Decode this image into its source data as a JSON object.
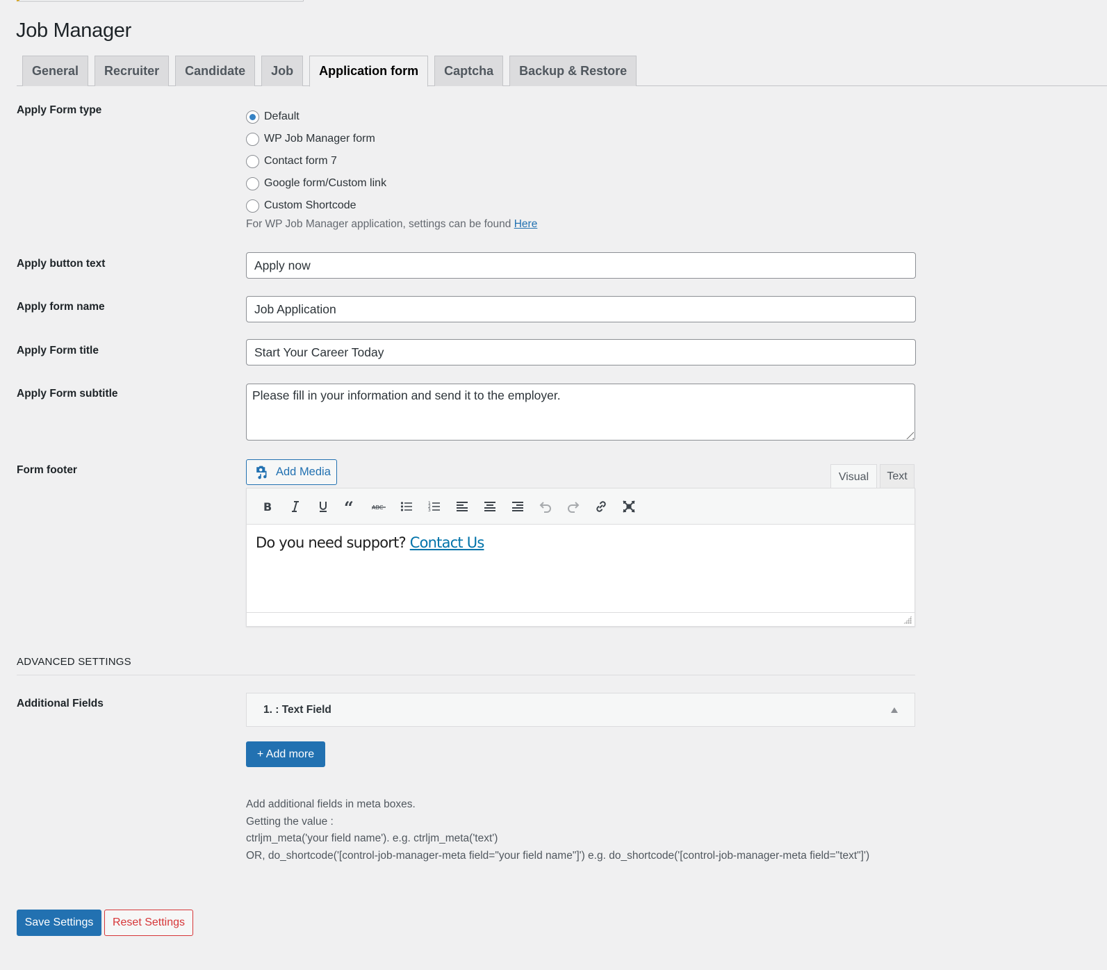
{
  "page": {
    "title": "Job Manager"
  },
  "tabs": [
    {
      "label": "General",
      "active": false
    },
    {
      "label": "Recruiter",
      "active": false
    },
    {
      "label": "Candidate",
      "active": false
    },
    {
      "label": "Job",
      "active": false
    },
    {
      "label": "Application form",
      "active": true
    },
    {
      "label": "Captcha",
      "active": false
    },
    {
      "label": "Backup & Restore",
      "active": false
    }
  ],
  "apply_form_type": {
    "label": "Apply Form type",
    "options": [
      {
        "label": "Default",
        "checked": true
      },
      {
        "label": "WP Job Manager form",
        "checked": false
      },
      {
        "label": "Contact form 7",
        "checked": false
      },
      {
        "label": "Google form/Custom link",
        "checked": false
      },
      {
        "label": "Custom Shortcode",
        "checked": false
      }
    ],
    "note": "For WP Job Manager application, settings can be found ",
    "note_link": "Here"
  },
  "fields": {
    "apply_button_text": {
      "label": "Apply button text",
      "value": "Apply now"
    },
    "apply_form_name": {
      "label": "Apply form name",
      "value": "Job Application"
    },
    "apply_form_title": {
      "label": "Apply Form title",
      "value": "Start Your Career Today"
    },
    "apply_form_subtitle": {
      "label": "Apply Form subtitle",
      "value": "Please fill in your information and send it to the employer."
    }
  },
  "form_footer": {
    "label": "Form footer",
    "add_media_label": "Add Media",
    "visual_tab": "Visual",
    "text_tab": "Text",
    "toolbar": [
      "bold",
      "italic",
      "underline",
      "blockquote",
      "strikethrough",
      "bulleted-list",
      "numbered-list",
      "align-left",
      "align-center",
      "align-right",
      "undo",
      "redo",
      "link",
      "fullscreen"
    ],
    "content_text": "Do you need support? ",
    "content_link": "Contact Us"
  },
  "advanced": {
    "heading": "ADVANCED SETTINGS",
    "additional_fields_label": "Additional Fields",
    "items": [
      {
        "label": "1. : Text Field"
      }
    ],
    "add_more_label": "+ Add more",
    "help_lines": [
      "Add additional fields in meta boxes.",
      "Getting the value :",
      "ctrljm_meta('your field name'). e.g. ctrljm_meta('text')",
      "OR, do_shortcode('[control-job-manager-meta field=\"your field name\"]') e.g. do_shortcode('[control-job-manager-meta field=\"text\"]')"
    ]
  },
  "actions": {
    "save_label": "Save Settings",
    "reset_label": "Reset Settings"
  },
  "colors": {
    "accent": "#2271b1",
    "danger": "#d63638",
    "background": "#f0f0f1"
  }
}
